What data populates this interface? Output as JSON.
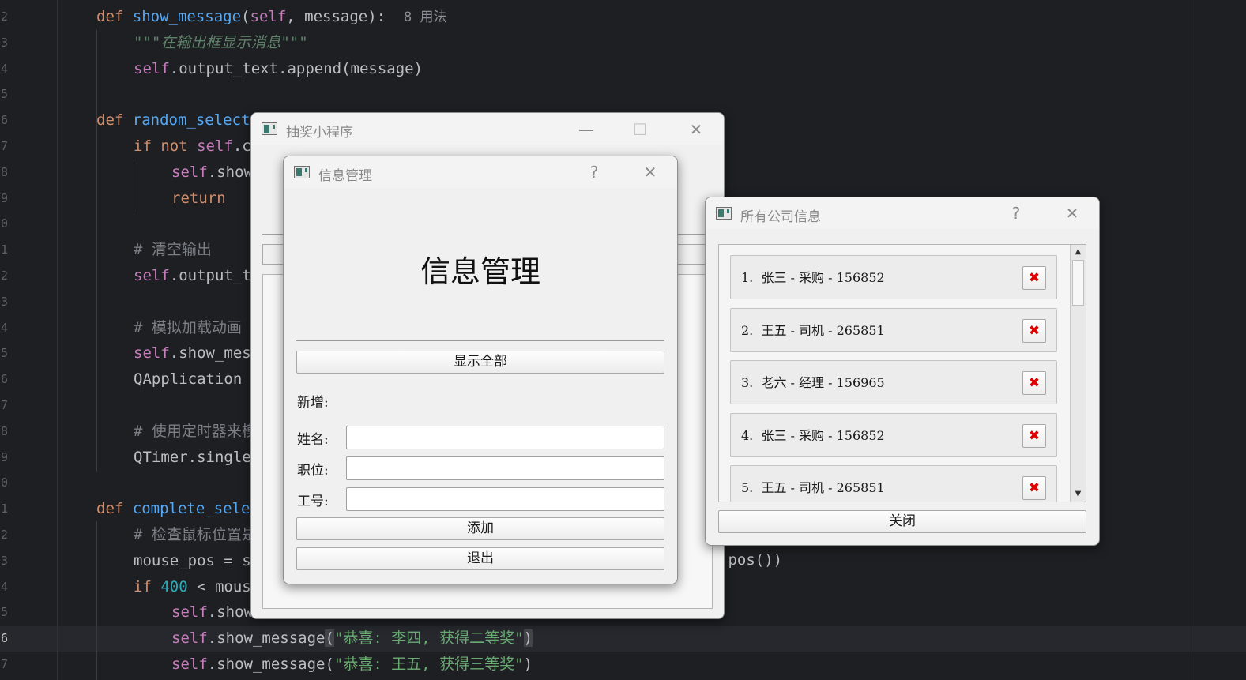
{
  "editor": {
    "line_numbers": [
      "2",
      "3",
      "4",
      "5",
      "6",
      "7",
      "8",
      "9",
      "0",
      "1",
      "2",
      "3",
      "4",
      "5",
      "6",
      "7",
      "8",
      "9",
      "0",
      "1",
      "2",
      "3",
      "4",
      "5",
      "6",
      "7"
    ],
    "current_line_number": "6",
    "lines": [
      {
        "parts": [
          {
            "c": "kw",
            "t": "def "
          },
          {
            "c": "fn",
            "t": "show_message"
          },
          {
            "c": "p",
            "t": "("
          },
          {
            "c": "self",
            "t": "self"
          },
          {
            "c": "p",
            "t": ", message):  "
          },
          {
            "c": "hint",
            "t": "8 用法"
          }
        ]
      },
      {
        "parts": [
          {
            "c": "doc",
            "t": "\"\"\"在输出框显示消息\"\"\""
          }
        ]
      },
      {
        "parts": [
          {
            "c": "self",
            "t": "self"
          },
          {
            "c": "p",
            "t": ".output_text.append(message)"
          }
        ]
      },
      {
        "parts": []
      },
      {
        "parts": [
          {
            "c": "kw",
            "t": "def "
          },
          {
            "c": "fn",
            "t": "random_select"
          }
        ]
      },
      {
        "parts": [
          {
            "c": "kw",
            "t": "if not "
          },
          {
            "c": "self",
            "t": "self"
          },
          {
            "c": "p",
            "t": ".c"
          }
        ]
      },
      {
        "parts": [
          {
            "c": "self",
            "t": "self"
          },
          {
            "c": "p",
            "t": ".show"
          }
        ]
      },
      {
        "parts": [
          {
            "c": "kw",
            "t": "return"
          }
        ]
      },
      {
        "parts": []
      },
      {
        "parts": [
          {
            "c": "cm",
            "t": "# 清空输出"
          }
        ]
      },
      {
        "parts": [
          {
            "c": "self",
            "t": "self"
          },
          {
            "c": "p",
            "t": ".output_t"
          }
        ]
      },
      {
        "parts": []
      },
      {
        "parts": [
          {
            "c": "cm",
            "t": "# 模拟加载动画"
          }
        ]
      },
      {
        "parts": [
          {
            "c": "self",
            "t": "self"
          },
          {
            "c": "p",
            "t": ".show_mes"
          }
        ]
      },
      {
        "parts": [
          {
            "c": "p",
            "t": "QApplication"
          }
        ]
      },
      {
        "parts": []
      },
      {
        "parts": [
          {
            "c": "cm",
            "t": "# 使用定时器来模"
          }
        ]
      },
      {
        "parts": [
          {
            "c": "p",
            "t": "QTimer.single"
          }
        ]
      },
      {
        "parts": []
      },
      {
        "parts": [
          {
            "c": "kw",
            "t": "def "
          },
          {
            "c": "fn",
            "t": "complete_sele"
          }
        ]
      },
      {
        "parts": [
          {
            "c": "cm",
            "t": "# 检查鼠标位置是"
          }
        ]
      },
      {
        "parts": [
          {
            "c": "p",
            "t": "mouse_pos = s"
          }
        ]
      },
      {
        "parts": [
          {
            "c": "kw",
            "t": "if "
          },
          {
            "c": "num",
            "t": "400"
          },
          {
            "c": "p",
            "t": " < mous"
          }
        ]
      },
      {
        "parts": [
          {
            "c": "self",
            "t": "self"
          },
          {
            "c": "p",
            "t": ".show"
          }
        ]
      },
      {
        "parts": [
          {
            "c": "self",
            "t": "self"
          },
          {
            "c": "p",
            "t": ".show_message"
          },
          {
            "c": "brk",
            "t": "("
          },
          {
            "c": "str",
            "t": "\"恭喜: 李四, 获得二等奖\""
          },
          {
            "c": "brk",
            "t": ")"
          }
        ]
      },
      {
        "parts": [
          {
            "c": "self",
            "t": "self"
          },
          {
            "c": "p",
            "t": ".show_message("
          },
          {
            "c": "str",
            "t": "\"恭喜: 王五, 获得三等奖\""
          },
          {
            "c": "p",
            "t": ")"
          }
        ]
      }
    ],
    "trailing_fragment": ".pos())"
  },
  "lottery_window": {
    "title": "抽奖小程序",
    "minimize_icon": "minimize-icon",
    "maximize_icon": "maximize-icon",
    "close_icon": "close-icon"
  },
  "info_dialog": {
    "title": "信息管理",
    "help_label": "?",
    "heading": "信息管理",
    "show_all_button": "显示全部",
    "add_section_label": "新增:",
    "name_label": "姓名:",
    "position_label": "职位:",
    "id_label": "工号:",
    "name_value": "",
    "position_value": "",
    "id_value": "",
    "add_button": "添加",
    "exit_button": "退出"
  },
  "company_dialog": {
    "title": "所有公司信息",
    "help_label": "?",
    "items": [
      {
        "text": "1.  张三 - 采购 - 156852",
        "delete_label": "✖"
      },
      {
        "text": "2.  王五 - 司机 - 265851",
        "delete_label": "✖"
      },
      {
        "text": "3.  老六 - 经理 - 156965",
        "delete_label": "✖"
      },
      {
        "text": "4.  张三 - 采购 - 156852",
        "delete_label": "✖"
      },
      {
        "text": "5.  王五 - 司机 - 265851",
        "delete_label": "✖"
      }
    ],
    "scroll_up": "▲",
    "scroll_down": "▼",
    "close_button": "关闭"
  },
  "colors": {
    "editor_bg": "#1e1f22",
    "keyword": "#cf8e6d",
    "function": "#56a8f5",
    "self": "#c77dbb",
    "string": "#6aab73",
    "comment": "#7a7e85",
    "delete_icon": "#e00000"
  }
}
